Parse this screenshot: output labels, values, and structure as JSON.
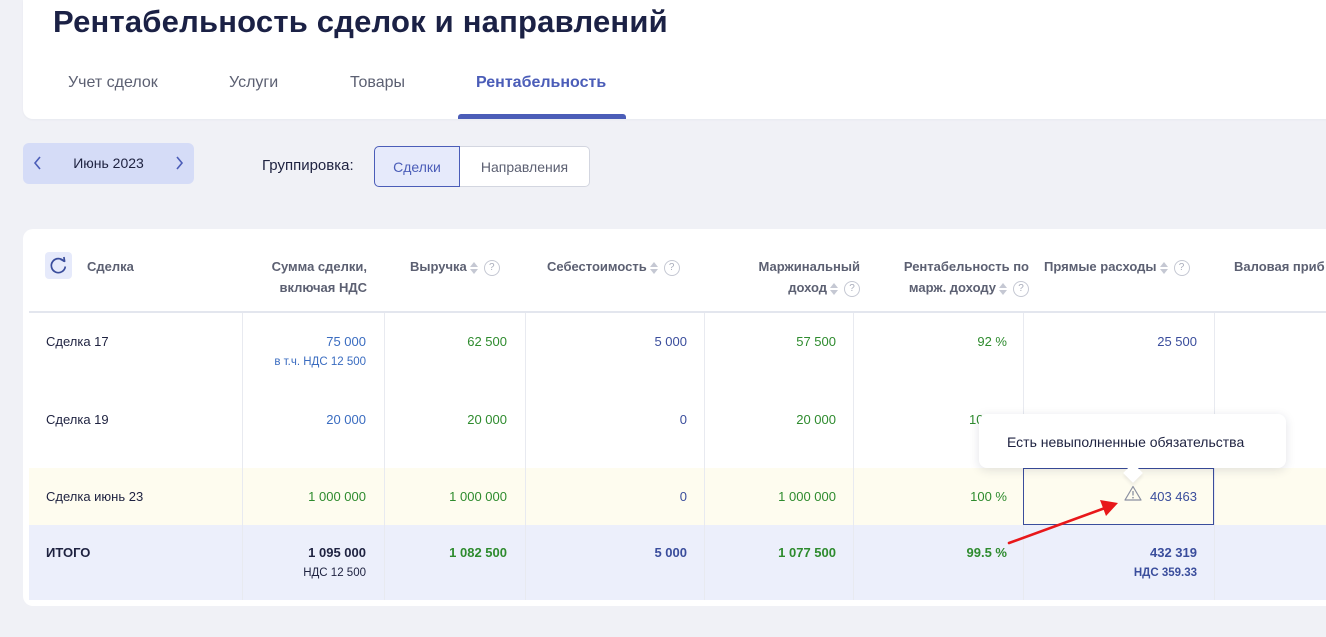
{
  "page": {
    "title": "Рентабельность сделок и направлений",
    "tabs": [
      {
        "label": "Учет сделок"
      },
      {
        "label": "Услуги"
      },
      {
        "label": "Товары"
      },
      {
        "label": "Рентабельность",
        "active": true
      }
    ]
  },
  "filters": {
    "month": "Июнь 2023",
    "grouping_label": "Группировка:",
    "grouping_options": [
      "Сделки",
      "Направления"
    ],
    "grouping_selected": "Сделки"
  },
  "table": {
    "columns": {
      "deal": "Сделка",
      "sum_line1": "Сумма сделки,",
      "sum_line2": "включая НДС",
      "revenue": "Выручка",
      "cost": "Себестоимость",
      "margin_line1": "Маржинальный",
      "margin_line2": "доход",
      "profit_line1": "Рентабельность по",
      "profit_line2": "марж. доходу",
      "direct": "Прямые расходы",
      "gross": "Валовая приб"
    },
    "help_glyph": "?",
    "rows": [
      {
        "name": "Сделка 17",
        "sum": "75 000",
        "sum_vat": "в т.ч. НДС 12 500",
        "revenue": "62 500",
        "cost": "5 000",
        "margin": "57 500",
        "profitability": "92 %",
        "direct": "25 500"
      },
      {
        "name": "Сделка 19",
        "sum": "20 000",
        "revenue": "20 000",
        "cost": "0",
        "margin": "20 000",
        "profitability": "10",
        "direct": ""
      },
      {
        "name": "Сделка июнь 23",
        "sum": "1 000 000",
        "revenue": "1 000 000",
        "cost": "0",
        "margin": "1 000 000",
        "profitability": "100 %",
        "direct": "403 463"
      }
    ],
    "total": {
      "name": "ИТОГО",
      "sum": "1 095 000",
      "sum_vat": "НДС 12 500",
      "revenue": "1 082 500",
      "cost": "5 000",
      "margin": "1 077 500",
      "profitability": "99.5 %",
      "direct": "432 319",
      "direct_vat": "НДС 359.33"
    }
  },
  "tooltip": {
    "text": "Есть невыполненные обязательства"
  },
  "colors": {
    "accent": "#4b5db8",
    "green": "#2e8b2e",
    "blue": "#3a6cc0",
    "annotation_arrow": "#e8171a"
  }
}
